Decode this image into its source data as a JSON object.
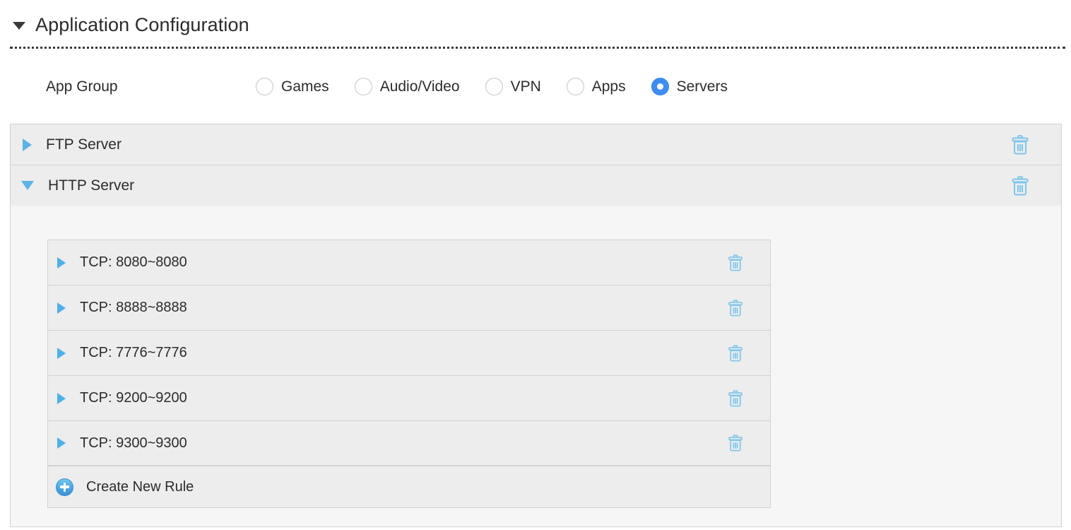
{
  "section": {
    "title": "Application Configuration",
    "collapse_icon": "triangle-down-icon",
    "expanded": true
  },
  "app_group": {
    "label": "App Group",
    "selected": "Servers",
    "options": [
      {
        "label": "Games",
        "selected": false
      },
      {
        "label": "Audio/Video",
        "selected": false
      },
      {
        "label": "VPN",
        "selected": false
      },
      {
        "label": "Apps",
        "selected": false
      },
      {
        "label": "Servers",
        "selected": true
      }
    ]
  },
  "applications": [
    {
      "name": "FTP Server",
      "expanded": false,
      "toggle_icon": "triangle-right-icon",
      "delete_icon": "trash-icon"
    },
    {
      "name": "HTTP Server",
      "expanded": true,
      "toggle_icon": "triangle-down-icon",
      "delete_icon": "trash-icon"
    }
  ],
  "rules": [
    {
      "name": "TCP: 8080~8080",
      "toggle_icon": "triangle-right-icon",
      "delete_icon": "trash-icon"
    },
    {
      "name": "TCP: 8888~8888",
      "toggle_icon": "triangle-right-icon",
      "delete_icon": "trash-icon"
    },
    {
      "name": "TCP: 7776~7776",
      "toggle_icon": "triangle-right-icon",
      "delete_icon": "trash-icon"
    },
    {
      "name": "TCP: 9200~9200",
      "toggle_icon": "triangle-right-icon",
      "delete_icon": "trash-icon"
    },
    {
      "name": "TCP: 9300~9300",
      "toggle_icon": "triangle-right-icon",
      "delete_icon": "trash-icon"
    }
  ],
  "create_rule": {
    "label": "Create New Rule",
    "icon": "plus-circle-icon"
  },
  "colors": {
    "accent_blue": "#5cb3e4",
    "radio_selected": "#3e8ef2",
    "row_background": "#ededed",
    "body_background": "#f6f6f6",
    "border": "#d2d2d2",
    "text": "#2b2b2b"
  }
}
